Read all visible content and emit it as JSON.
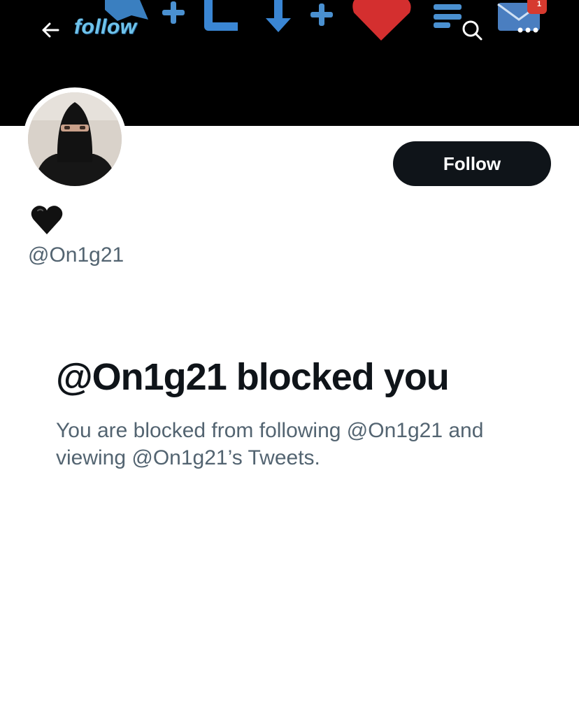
{
  "header": {
    "banner_text": "follow",
    "notification_count": "1",
    "back_icon": "arrow-left-icon",
    "search_icon": "search-icon",
    "more_icon": "more-horizontal-icon"
  },
  "profile": {
    "display_name_icon": "black-heart-icon",
    "handle": "@On1g21",
    "follow_label": "Follow"
  },
  "blocked": {
    "title": "@On1g21 blocked you",
    "description": "You are blocked from following @On1g21 and viewing @On1g21’s Tweets."
  },
  "colors": {
    "banner_bg": "#000000",
    "button_bg": "#0f1419",
    "text_primary": "#0f1419",
    "text_secondary": "#536471"
  }
}
